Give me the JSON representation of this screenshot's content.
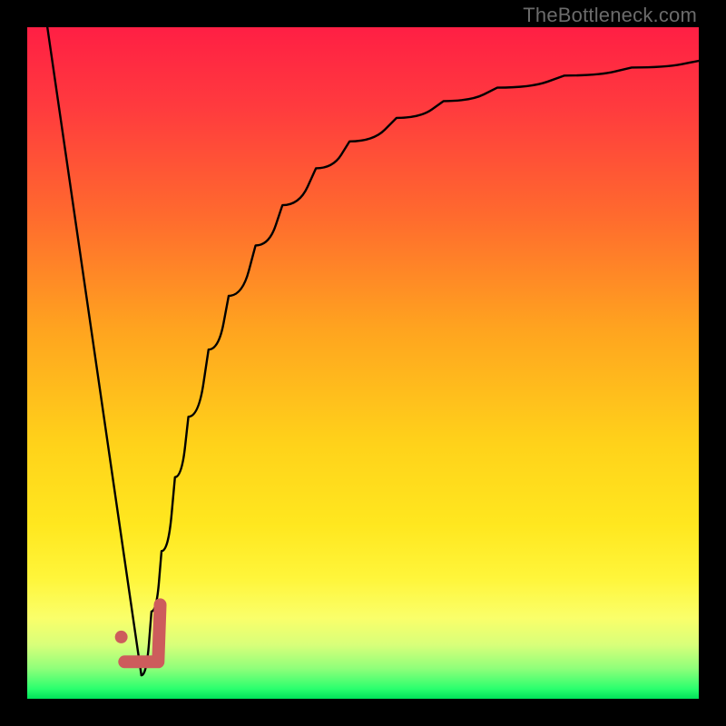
{
  "watermark": {
    "text": "TheBottleneck.com"
  },
  "gradient": {
    "stops": [
      {
        "offset": 0.0,
        "color": "#ff1f44"
      },
      {
        "offset": 0.12,
        "color": "#ff3b3e"
      },
      {
        "offset": 0.28,
        "color": "#ff6a2e"
      },
      {
        "offset": 0.45,
        "color": "#ffa41f"
      },
      {
        "offset": 0.62,
        "color": "#ffd21a"
      },
      {
        "offset": 0.74,
        "color": "#ffe71f"
      },
      {
        "offset": 0.82,
        "color": "#fff53a"
      },
      {
        "offset": 0.88,
        "color": "#faff6a"
      },
      {
        "offset": 0.92,
        "color": "#d8ff7a"
      },
      {
        "offset": 0.955,
        "color": "#8fff7a"
      },
      {
        "offset": 0.985,
        "color": "#2bff6e"
      },
      {
        "offset": 1.0,
        "color": "#00e25a"
      }
    ]
  },
  "marker": {
    "dot": {
      "x_pct": 14.0,
      "y_pct": 90.8,
      "r": 7,
      "color": "#cd5c5c"
    },
    "stroke": {
      "color": "#cd5c5c",
      "width": 14,
      "points_pct": [
        {
          "x": 14.5,
          "y": 94.5
        },
        {
          "x": 19.5,
          "y": 94.5
        },
        {
          "x": 19.8,
          "y": 86.0
        }
      ]
    }
  },
  "curve_style": {
    "color": "#000000",
    "width": 2.4
  },
  "chart_data": {
    "type": "line",
    "title": "",
    "xlabel": "",
    "ylabel": "",
    "xlim": [
      0,
      100
    ],
    "ylim": [
      0,
      100
    ],
    "grid": false,
    "legend_position": "none",
    "series": [
      {
        "name": "left-descending",
        "x": [
          3.0,
          17.0
        ],
        "y": [
          100.0,
          3.5
        ]
      },
      {
        "name": "right-asymptote",
        "x": [
          17.0,
          18.5,
          20.0,
          22.0,
          24.0,
          27.0,
          30.0,
          34.0,
          38.0,
          43.0,
          48.0,
          55.0,
          62.0,
          70.0,
          80.0,
          90.0,
          100.0
        ],
        "y": [
          3.5,
          13.0,
          22.0,
          33.0,
          42.0,
          52.0,
          60.0,
          67.5,
          73.5,
          79.0,
          83.0,
          86.5,
          89.0,
          91.0,
          92.8,
          94.0,
          95.0
        ]
      }
    ],
    "annotations": [
      {
        "type": "dot",
        "x": 14.0,
        "y": 9.2,
        "color": "#cd5c5c"
      },
      {
        "type": "check",
        "points": [
          [
            14.5,
            5.5
          ],
          [
            19.5,
            5.5
          ],
          [
            19.8,
            14.0
          ]
        ],
        "color": "#cd5c5c"
      }
    ]
  }
}
